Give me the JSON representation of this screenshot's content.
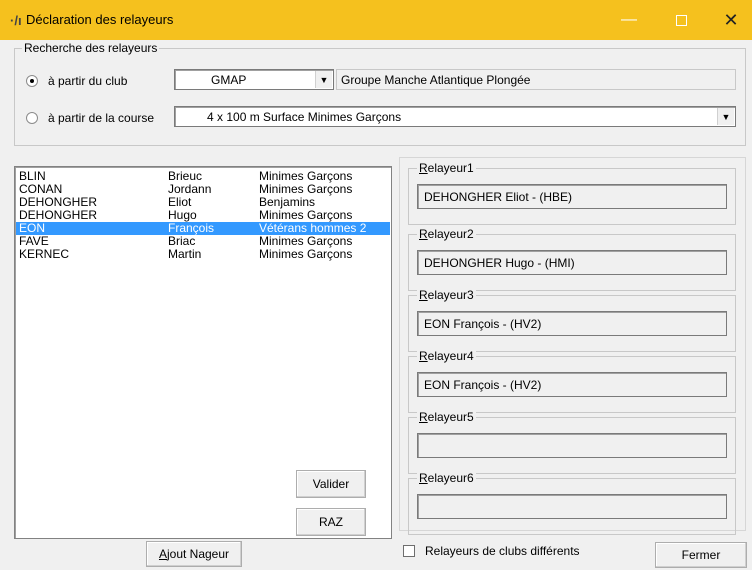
{
  "window": {
    "title": "Déclaration des relayeurs",
    "minimize": "—",
    "close": "✕"
  },
  "search": {
    "legend": "Recherche des relayeurs",
    "club_radio_label": "à partir du club",
    "course_radio_label": "à partir de la course",
    "club_code": "GMAP",
    "club_name": "Groupe Manche Atlantique Plongée",
    "course": "4 x 100 m Surface  Minimes Garçons"
  },
  "swimmers": [
    {
      "last": "BLIN",
      "first": "Brieuc",
      "category": "Minimes Garçons",
      "selected": false
    },
    {
      "last": "CONAN",
      "first": "Jordann",
      "category": "Minimes Garçons",
      "selected": false
    },
    {
      "last": "DEHONGHER",
      "first": "Eliot",
      "category": "Benjamins",
      "selected": false
    },
    {
      "last": "DEHONGHER",
      "first": "Hugo",
      "category": "Minimes Garçons",
      "selected": false
    },
    {
      "last": "EON",
      "first": "François",
      "category": "Vétérans hommes 2",
      "selected": true
    },
    {
      "last": "FAVE",
      "first": "Briac",
      "category": "Minimes Garçons",
      "selected": false
    },
    {
      "last": "KERNEC",
      "first": "Martin",
      "category": "Minimes Garçons",
      "selected": false
    }
  ],
  "relays": [
    {
      "label_first": "R",
      "label_rest": "elayeur1",
      "value": "DEHONGHER Eliot  - (HBE)"
    },
    {
      "label_first": "R",
      "label_rest": "elayeur2",
      "value": "DEHONGHER Hugo  - (HMI)"
    },
    {
      "label_first": "R",
      "label_rest": "elayeur3",
      "value": "EON François  - (HV2)"
    },
    {
      "label_first": "R",
      "label_rest": "elayeur4",
      "value": "EON François  - (HV2)"
    },
    {
      "label_first": "R",
      "label_rest": "elayeur5",
      "value": ""
    },
    {
      "label_first": "R",
      "label_rest": "elayeur6",
      "value": ""
    }
  ],
  "buttons": {
    "validate": "Valider",
    "reset": "RAZ",
    "add_swimmer_first": "A",
    "add_swimmer_rest": "jout Nageur",
    "close": "Fermer"
  },
  "different_clubs_label": "Relayeurs de clubs différents"
}
